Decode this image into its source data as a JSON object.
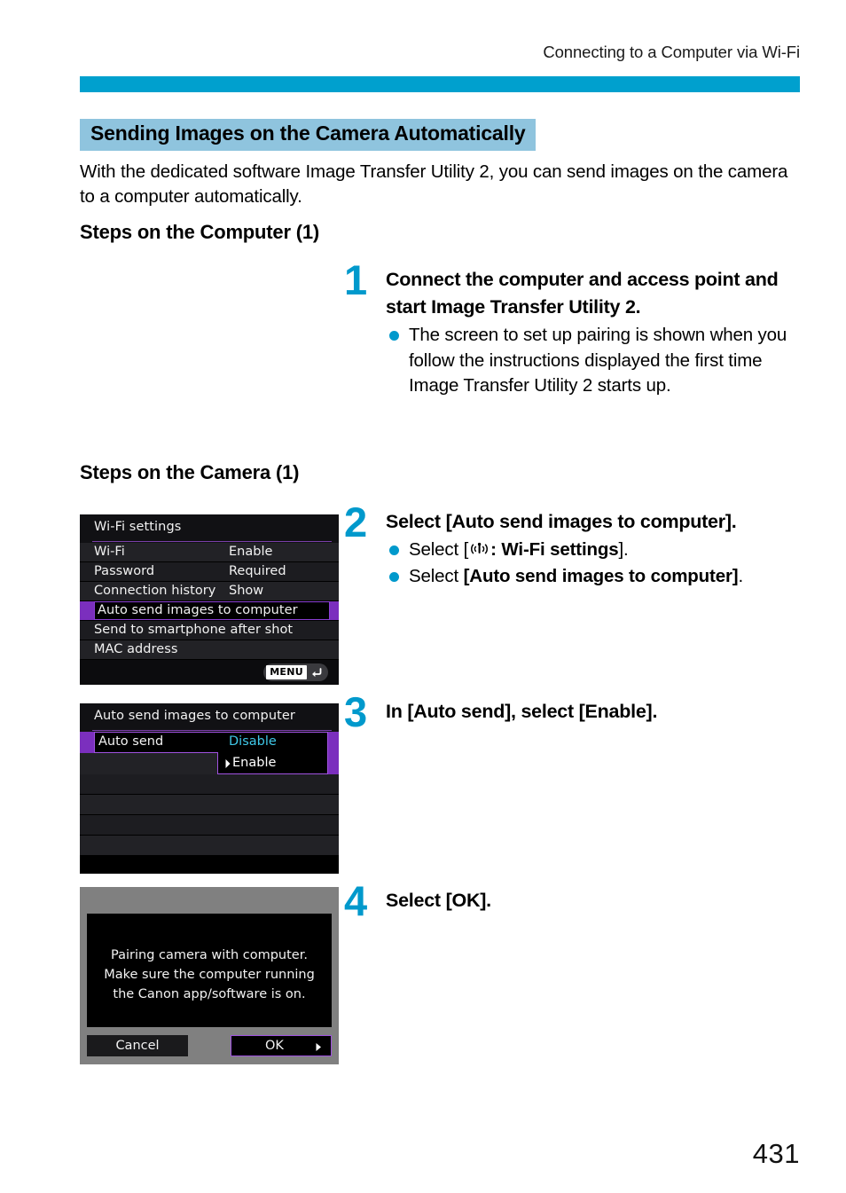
{
  "header": {
    "running_title": "Connecting to a Computer via Wi-Fi",
    "rule_color": "#00a0ce"
  },
  "section": {
    "heading": "Sending Images on the Camera Automatically",
    "heading_highlight_color": "#8fc4de",
    "intro": "With the dedicated software Image Transfer Utility 2, you can send images on the camera to a computer automatically."
  },
  "subheads": {
    "computer": "Steps on the Computer (1)",
    "camera": "Steps on the Camera (1)"
  },
  "steps": [
    {
      "number": "1",
      "title": "Connect the computer and access point and start Image Transfer Utility 2.",
      "bullets": [
        "The screen to set up pairing is shown when you follow the instructions displayed the first time Image Transfer Utility 2 starts up."
      ]
    },
    {
      "number": "2",
      "title": "Select [Auto send images to computer].",
      "bullet_2a_prefix": "Select [",
      "bullet_2a_icon": "wifi-icon",
      "bullet_2a_mid": ": Wi-Fi settings",
      "bullet_2a_suffix": "].",
      "bullet_2b_prefix": "Select ",
      "bullet_2b_bold": "[Auto send images to computer]",
      "bullet_2b_suffix": "."
    },
    {
      "number": "3",
      "title": "In [Auto send], select [Enable]."
    },
    {
      "number": "4",
      "title": "Select [OK]."
    }
  ],
  "screens": {
    "wifi_settings": {
      "title": "Wi-Fi settings",
      "rows": [
        {
          "label": "Wi-Fi",
          "value": "Enable",
          "selected": false
        },
        {
          "label": "Password",
          "value": "Required",
          "selected": false
        },
        {
          "label": "Connection history",
          "value": "Show",
          "selected": false
        },
        {
          "label": "Auto send images to computer",
          "value": "",
          "selected": true
        },
        {
          "label": "Send to smartphone after shot",
          "value": "",
          "selected": false
        },
        {
          "label": "MAC address",
          "value": "",
          "selected": false
        }
      ],
      "menu_button_label": "MENU",
      "menu_button_icon": "return-arrow-icon",
      "highlight_color": "#7b2fbe"
    },
    "auto_send": {
      "title": "Auto send images to computer",
      "setting_label": "Auto send",
      "setting_current_value": "Disable",
      "dropdown_option": "Enable",
      "current_value_color": "#3fc8e8",
      "highlight_color": "#7b2fbe"
    },
    "pairing_dialog": {
      "message_line1": "Pairing camera with computer.",
      "message_line2": "Make sure the computer running",
      "message_line3": "the Canon app/software is on.",
      "cancel_label": "Cancel",
      "ok_label": "OK",
      "ok_arrow_icon": "right-arrow-icon",
      "selected_button": "OK"
    }
  },
  "footer": {
    "page_number": "431"
  }
}
